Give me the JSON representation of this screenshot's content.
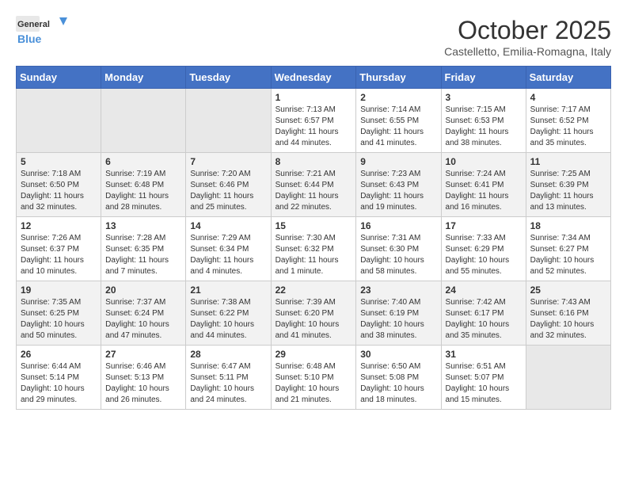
{
  "logo": {
    "line1": "General",
    "line2": "Blue"
  },
  "header": {
    "month": "October 2025",
    "location": "Castelletto, Emilia-Romagna, Italy"
  },
  "days_of_week": [
    "Sunday",
    "Monday",
    "Tuesday",
    "Wednesday",
    "Thursday",
    "Friday",
    "Saturday"
  ],
  "weeks": [
    [
      {
        "day": "",
        "info": ""
      },
      {
        "day": "",
        "info": ""
      },
      {
        "day": "",
        "info": ""
      },
      {
        "day": "1",
        "info": "Sunrise: 7:13 AM\nSunset: 6:57 PM\nDaylight: 11 hours and 44 minutes."
      },
      {
        "day": "2",
        "info": "Sunrise: 7:14 AM\nSunset: 6:55 PM\nDaylight: 11 hours and 41 minutes."
      },
      {
        "day": "3",
        "info": "Sunrise: 7:15 AM\nSunset: 6:53 PM\nDaylight: 11 hours and 38 minutes."
      },
      {
        "day": "4",
        "info": "Sunrise: 7:17 AM\nSunset: 6:52 PM\nDaylight: 11 hours and 35 minutes."
      }
    ],
    [
      {
        "day": "5",
        "info": "Sunrise: 7:18 AM\nSunset: 6:50 PM\nDaylight: 11 hours and 32 minutes."
      },
      {
        "day": "6",
        "info": "Sunrise: 7:19 AM\nSunset: 6:48 PM\nDaylight: 11 hours and 28 minutes."
      },
      {
        "day": "7",
        "info": "Sunrise: 7:20 AM\nSunset: 6:46 PM\nDaylight: 11 hours and 25 minutes."
      },
      {
        "day": "8",
        "info": "Sunrise: 7:21 AM\nSunset: 6:44 PM\nDaylight: 11 hours and 22 minutes."
      },
      {
        "day": "9",
        "info": "Sunrise: 7:23 AM\nSunset: 6:43 PM\nDaylight: 11 hours and 19 minutes."
      },
      {
        "day": "10",
        "info": "Sunrise: 7:24 AM\nSunset: 6:41 PM\nDaylight: 11 hours and 16 minutes."
      },
      {
        "day": "11",
        "info": "Sunrise: 7:25 AM\nSunset: 6:39 PM\nDaylight: 11 hours and 13 minutes."
      }
    ],
    [
      {
        "day": "12",
        "info": "Sunrise: 7:26 AM\nSunset: 6:37 PM\nDaylight: 11 hours and 10 minutes."
      },
      {
        "day": "13",
        "info": "Sunrise: 7:28 AM\nSunset: 6:35 PM\nDaylight: 11 hours and 7 minutes."
      },
      {
        "day": "14",
        "info": "Sunrise: 7:29 AM\nSunset: 6:34 PM\nDaylight: 11 hours and 4 minutes."
      },
      {
        "day": "15",
        "info": "Sunrise: 7:30 AM\nSunset: 6:32 PM\nDaylight: 11 hours and 1 minute."
      },
      {
        "day": "16",
        "info": "Sunrise: 7:31 AM\nSunset: 6:30 PM\nDaylight: 10 hours and 58 minutes."
      },
      {
        "day": "17",
        "info": "Sunrise: 7:33 AM\nSunset: 6:29 PM\nDaylight: 10 hours and 55 minutes."
      },
      {
        "day": "18",
        "info": "Sunrise: 7:34 AM\nSunset: 6:27 PM\nDaylight: 10 hours and 52 minutes."
      }
    ],
    [
      {
        "day": "19",
        "info": "Sunrise: 7:35 AM\nSunset: 6:25 PM\nDaylight: 10 hours and 50 minutes."
      },
      {
        "day": "20",
        "info": "Sunrise: 7:37 AM\nSunset: 6:24 PM\nDaylight: 10 hours and 47 minutes."
      },
      {
        "day": "21",
        "info": "Sunrise: 7:38 AM\nSunset: 6:22 PM\nDaylight: 10 hours and 44 minutes."
      },
      {
        "day": "22",
        "info": "Sunrise: 7:39 AM\nSunset: 6:20 PM\nDaylight: 10 hours and 41 minutes."
      },
      {
        "day": "23",
        "info": "Sunrise: 7:40 AM\nSunset: 6:19 PM\nDaylight: 10 hours and 38 minutes."
      },
      {
        "day": "24",
        "info": "Sunrise: 7:42 AM\nSunset: 6:17 PM\nDaylight: 10 hours and 35 minutes."
      },
      {
        "day": "25",
        "info": "Sunrise: 7:43 AM\nSunset: 6:16 PM\nDaylight: 10 hours and 32 minutes."
      }
    ],
    [
      {
        "day": "26",
        "info": "Sunrise: 6:44 AM\nSunset: 5:14 PM\nDaylight: 10 hours and 29 minutes."
      },
      {
        "day": "27",
        "info": "Sunrise: 6:46 AM\nSunset: 5:13 PM\nDaylight: 10 hours and 26 minutes."
      },
      {
        "day": "28",
        "info": "Sunrise: 6:47 AM\nSunset: 5:11 PM\nDaylight: 10 hours and 24 minutes."
      },
      {
        "day": "29",
        "info": "Sunrise: 6:48 AM\nSunset: 5:10 PM\nDaylight: 10 hours and 21 minutes."
      },
      {
        "day": "30",
        "info": "Sunrise: 6:50 AM\nSunset: 5:08 PM\nDaylight: 10 hours and 18 minutes."
      },
      {
        "day": "31",
        "info": "Sunrise: 6:51 AM\nSunset: 5:07 PM\nDaylight: 10 hours and 15 minutes."
      },
      {
        "day": "",
        "info": ""
      }
    ]
  ]
}
